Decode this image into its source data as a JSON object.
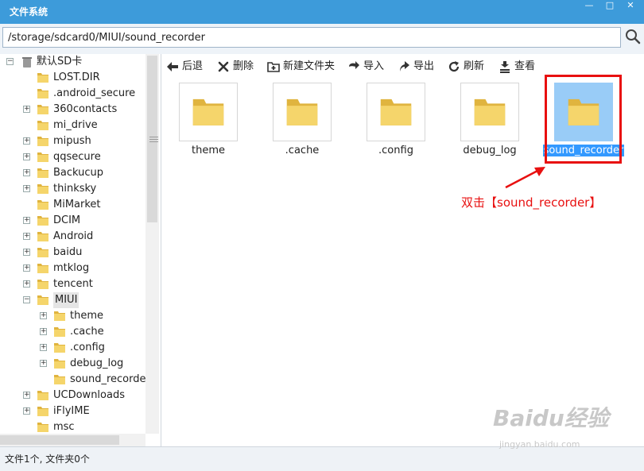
{
  "window": {
    "title": "文件系统",
    "controls": [
      "—",
      "□",
      "✕"
    ]
  },
  "path": {
    "value": "/storage/sdcard0/MIUI/sound_recorder",
    "search_icon": "search-icon"
  },
  "sidebar": {
    "root": "默认SD卡",
    "items": [
      {
        "label": "LOST.DIR",
        "expandable": false
      },
      {
        "label": ".android_secure",
        "expandable": false
      },
      {
        "label": "360contacts",
        "expandable": true
      },
      {
        "label": "mi_drive",
        "expandable": false
      },
      {
        "label": "mipush",
        "expandable": true
      },
      {
        "label": "qqsecure",
        "expandable": true
      },
      {
        "label": "Backucup",
        "expandable": true
      },
      {
        "label": "thinksky",
        "expandable": true
      },
      {
        "label": "MiMarket",
        "expandable": false
      },
      {
        "label": "DCIM",
        "expandable": true
      },
      {
        "label": "Android",
        "expandable": true
      },
      {
        "label": "baidu",
        "expandable": true
      },
      {
        "label": "mtklog",
        "expandable": true
      },
      {
        "label": "tencent",
        "expandable": true
      },
      {
        "label": "MIUI",
        "expandable": true,
        "expanded": true,
        "selected": true
      },
      {
        "label": "theme",
        "expandable": true,
        "child": true
      },
      {
        "label": ".cache",
        "expandable": true,
        "child": true
      },
      {
        "label": ".config",
        "expandable": true,
        "child": true
      },
      {
        "label": "debug_log",
        "expandable": true,
        "child": true
      },
      {
        "label": "sound_recorder",
        "expandable": false,
        "child": true
      },
      {
        "label": "UCDownloads",
        "expandable": true
      },
      {
        "label": "iFlyIME",
        "expandable": true
      },
      {
        "label": "msc",
        "expandable": false
      }
    ]
  },
  "toolbar": {
    "back": "后退",
    "delete": "删除",
    "new_folder": "新建文件夹",
    "import": "导入",
    "export": "导出",
    "refresh": "刷新",
    "view": "查看"
  },
  "files": [
    {
      "name": "theme",
      "selected": false
    },
    {
      "name": ".cache",
      "selected": false
    },
    {
      "name": ".config",
      "selected": false
    },
    {
      "name": "debug_log",
      "selected": false
    },
    {
      "name": "sound_recorder",
      "selected": true
    }
  ],
  "annotation": "双击【sound_recorder】",
  "status": "文件1个, 文件夹0个",
  "watermark": {
    "main": "Baidu经验",
    "sub": "jingyan.baidu.com"
  },
  "colors": {
    "titlebar": "#3d9bda",
    "selection": "#3399ff",
    "annotation": "#e81010",
    "folder": "#f2cf5c"
  }
}
